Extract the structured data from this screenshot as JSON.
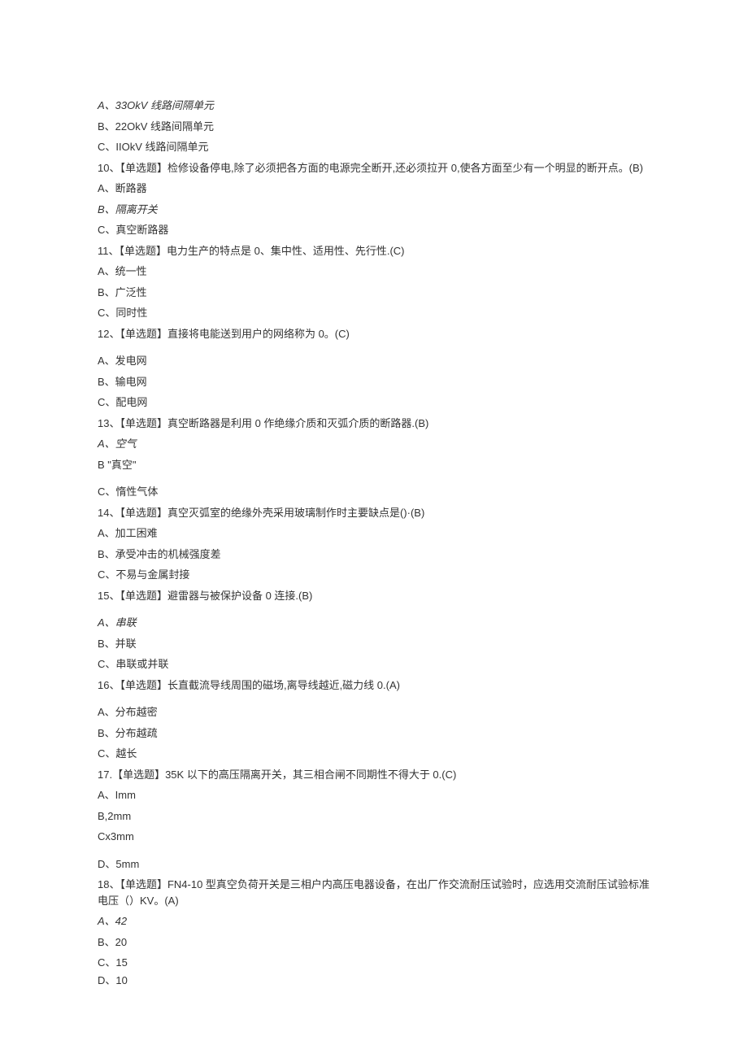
{
  "q9_opts": {
    "a": "A、33OkV 线路间隔单元",
    "b": "B、22OkV 线路间隔单元",
    "c": "C、IIOkV 线路间隔单元"
  },
  "q10": {
    "stem": "10、【单选题】检修设备停电,除了必须把各方面的电源完全断开,还必须拉开 0,使各方面至少有一个明显的断开点。(B)",
    "a": "A、断路器",
    "b": "B、隔离开关",
    "c": "C、真空断路器"
  },
  "q11": {
    "stem": "11、【单选题】电力生产的特点是 0、集中性、适用性、先行性.(C)",
    "a": "A、统一性",
    "b": "B、广泛性",
    "c": "C、同时性"
  },
  "q12": {
    "stem": "12、【单选题】直接将电能送到用户的网络称为 0。(C)",
    "a": "A、发电网",
    "b": "B、输电网",
    "c": "C、配电网"
  },
  "q13": {
    "stem": "13、【单选题】真空断路器是利用 0 作绝缘介质和灭弧介质的断路器.(B)",
    "a": "A、空气",
    "b": "B \"真空\"",
    "c": "C、惰性气体"
  },
  "q14": {
    "stem": "14、【单选题】真空灭弧室的绝缘外壳采用玻璃制作时主要缺点是()·(B)",
    "a": "A、加工困难",
    "b": "B、承受冲击的机械强度差",
    "c": "C、不易与金属封接"
  },
  "q15": {
    "stem": "15、【单选题】避雷器与被保护设备 0 连接.(B)",
    "a": "A、串联",
    "b": "B、并联",
    "c": "C、串联或并联"
  },
  "q16": {
    "stem": "16、【单选题】长直截流导线周围的磁场,离导线越近,磁力线 0.(A)",
    "a": "A、分布越密",
    "b": "B、分布越疏",
    "c": "C、越长"
  },
  "q17": {
    "stem": "17.【单选题】35K 以下的高压隔离开关，其三相合闸不同期性不得大于 0.(C)",
    "a": "A、Imm",
    "b": "B,2mm",
    "c": "Cx3mm",
    "d": "D、5mm"
  },
  "q18": {
    "stem": "18、【单选题】FN4-10 型真空负荷开关是三相户内高压电器设备，在出厂作交流耐压试验时，应选用交流耐压试验标准电压（）KV。(A)",
    "a": "A、42",
    "b": "B、20",
    "c": "C、15",
    "d": "D、10"
  }
}
